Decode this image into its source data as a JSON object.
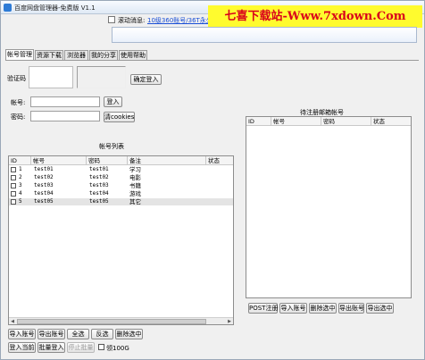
{
  "window": {
    "title": "百度网盘管理器-免费版 V1.1"
  },
  "marquee": {
    "label": "滚动消息:",
    "link": "10级360账号/36T永久免"
  },
  "watermark": {
    "text": "七喜下载站-Www.7xdown.Com"
  },
  "tabs": [
    {
      "label": "帐号管理",
      "active": true
    },
    {
      "label": "资源下载",
      "active": false
    },
    {
      "label": "浏览器",
      "active": false
    },
    {
      "label": "我的分享",
      "active": false
    },
    {
      "label": "使用帮助",
      "active": false
    }
  ],
  "login": {
    "captcha_label": "验证码",
    "confirm_login": "确定登入",
    "account_label": "帐号:",
    "password_label": "密码:",
    "login_button": "登入",
    "clear_cookies": "清cookies"
  },
  "account_list": {
    "title": "帐号列表",
    "columns": [
      "ID",
      "帐号",
      "密码",
      "备注",
      "状态"
    ],
    "rows": [
      {
        "id": "1",
        "account": "test01",
        "password": "test01",
        "note": "学习",
        "status": ""
      },
      {
        "id": "2",
        "account": "test02",
        "password": "test02",
        "note": "电影",
        "status": ""
      },
      {
        "id": "3",
        "account": "test03",
        "password": "test03",
        "note": "书籍",
        "status": ""
      },
      {
        "id": "4",
        "account": "test04",
        "password": "test04",
        "note": "游戏",
        "status": ""
      },
      {
        "id": "5",
        "account": "test05",
        "password": "test05",
        "note": "其它",
        "status": ""
      }
    ]
  },
  "account_buttons": {
    "import": "导入账号",
    "export": "导出账号",
    "select_all": "全选",
    "invert": "反选",
    "delete_selected": "删除选中",
    "login_current": "登入当前",
    "batch_login": "批量登入",
    "stop_batch": "停止批量",
    "checkbox_label": "领100G"
  },
  "pending": {
    "title": "待注册邮箱帐号",
    "columns": [
      "ID",
      "帐号",
      "密码",
      "状态"
    ],
    "buttons": {
      "post_register": "POST注册",
      "import": "导入账号",
      "delete_selected": "删除选中",
      "export": "导出账号",
      "export_selected": "导出选中"
    }
  }
}
